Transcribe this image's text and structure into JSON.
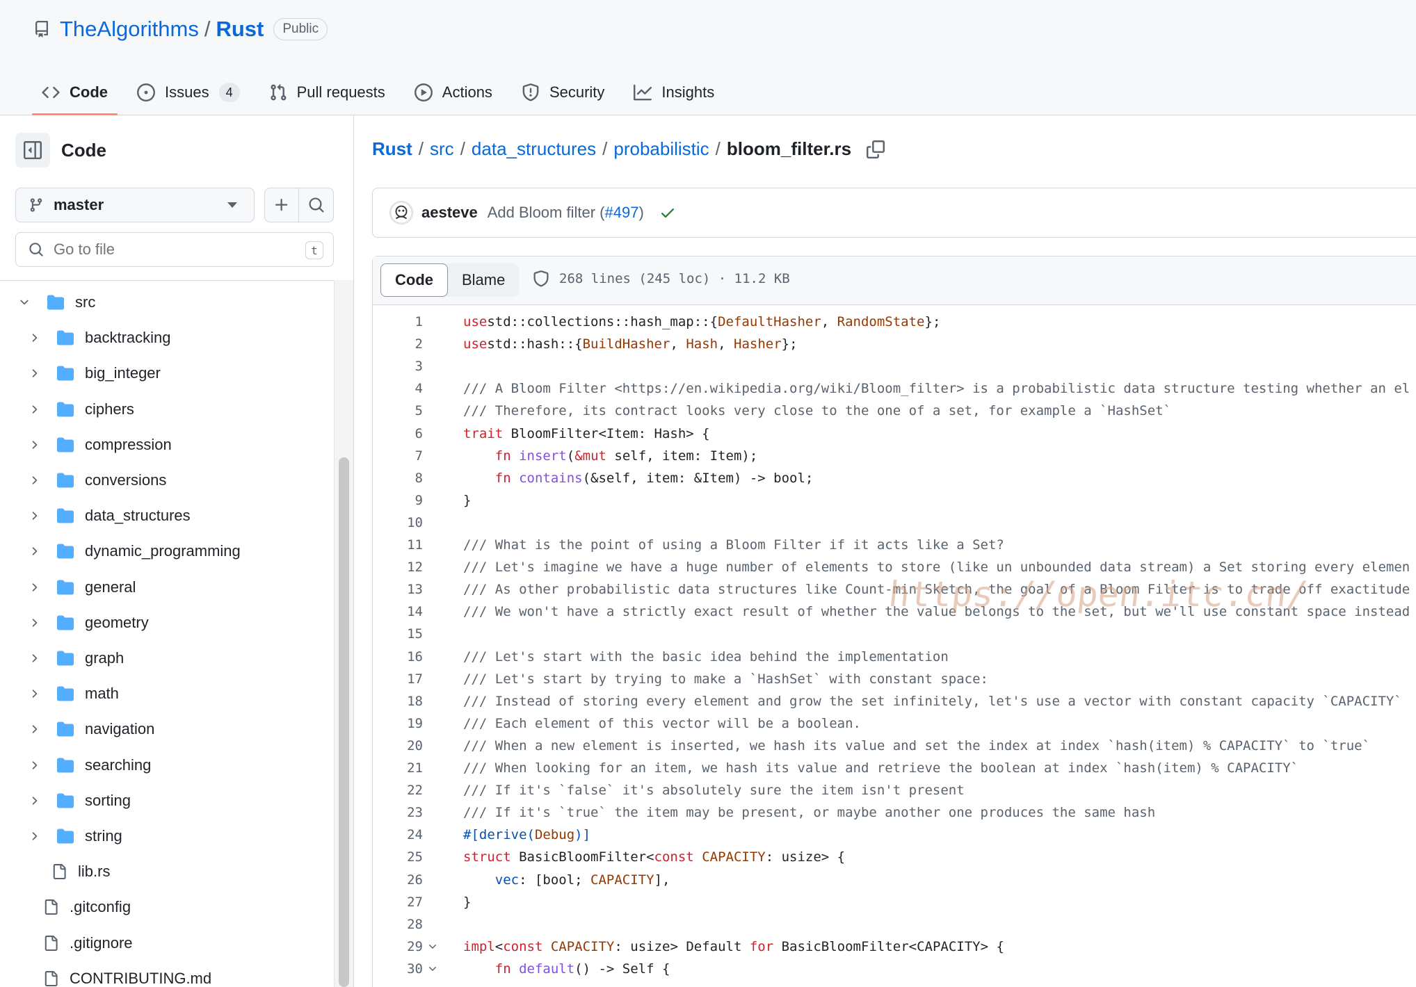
{
  "repo": {
    "owner": "TheAlgorithms",
    "name": "Rust",
    "visibility": "Public"
  },
  "tabs": [
    {
      "label": "Code",
      "active": true,
      "icon": "code-icon"
    },
    {
      "label": "Issues",
      "count": "4",
      "icon": "issue-opened-icon"
    },
    {
      "label": "Pull requests",
      "icon": "pull-request-icon"
    },
    {
      "label": "Actions",
      "icon": "play-icon"
    },
    {
      "label": "Security",
      "icon": "shield-icon"
    },
    {
      "label": "Insights",
      "icon": "graph-icon"
    }
  ],
  "sidebar": {
    "title": "Code",
    "branch": "master",
    "goto_placeholder": "Go to file",
    "goto_shortcut": "t",
    "tree": [
      {
        "name": "src",
        "kind": "folder",
        "expanded": true,
        "depth": 0
      },
      {
        "name": "backtracking",
        "kind": "folder",
        "depth": 1
      },
      {
        "name": "big_integer",
        "kind": "folder",
        "depth": 1
      },
      {
        "name": "ciphers",
        "kind": "folder",
        "depth": 1
      },
      {
        "name": "compression",
        "kind": "folder",
        "depth": 1
      },
      {
        "name": "conversions",
        "kind": "folder",
        "depth": 1
      },
      {
        "name": "data_structures",
        "kind": "folder",
        "depth": 1
      },
      {
        "name": "dynamic_programming",
        "kind": "folder",
        "depth": 1
      },
      {
        "name": "general",
        "kind": "folder",
        "depth": 1
      },
      {
        "name": "geometry",
        "kind": "folder",
        "depth": 1
      },
      {
        "name": "graph",
        "kind": "folder",
        "depth": 1
      },
      {
        "name": "math",
        "kind": "folder",
        "depth": 1
      },
      {
        "name": "navigation",
        "kind": "folder",
        "depth": 1
      },
      {
        "name": "searching",
        "kind": "folder",
        "depth": 1
      },
      {
        "name": "sorting",
        "kind": "folder",
        "depth": 1
      },
      {
        "name": "string",
        "kind": "folder",
        "depth": 1
      },
      {
        "name": "lib.rs",
        "kind": "file",
        "depth": 1
      },
      {
        "name": ".gitconfig",
        "kind": "file",
        "depth": 0
      },
      {
        "name": ".gitignore",
        "kind": "file",
        "depth": 0
      },
      {
        "name": "CONTRIBUTING.md",
        "kind": "file",
        "depth": 0
      }
    ]
  },
  "breadcrumb": {
    "repo": "Rust",
    "parts": [
      "src",
      "data_structures",
      "probabilistic"
    ],
    "current": "bloom_filter.rs"
  },
  "commit": {
    "author": "aesteve",
    "message": "Add Bloom filter (",
    "pr": "#497",
    "message_end": ")"
  },
  "file": {
    "view_tabs": [
      "Code",
      "Blame"
    ],
    "info": "268 lines (245 loc) · 11.2 KB"
  },
  "code_lines": [
    [
      [
        "kw",
        "use"
      ],
      [
        "",
        "std::collections::hash_map::{"
      ],
      [
        "ty",
        "DefaultHasher"
      ],
      [
        "",
        ", "
      ],
      [
        "ty",
        "RandomState"
      ],
      [
        "",
        "};"
      ]
    ],
    [
      [
        "kw",
        "use"
      ],
      [
        "",
        "std::hash::{"
      ],
      [
        "ty",
        "BuildHasher"
      ],
      [
        "",
        ", "
      ],
      [
        "ty",
        "Hash"
      ],
      [
        "",
        ", "
      ],
      [
        "ty",
        "Hasher"
      ],
      [
        "",
        "};"
      ]
    ],
    [],
    [
      [
        "cm",
        "/// A Bloom Filter <https://en.wikipedia.org/wiki/Bloom_filter> is a probabilistic data structure testing whether an el"
      ]
    ],
    [
      [
        "cm",
        "/// Therefore, its contract looks very close to the one of a set, for example a `HashSet`"
      ]
    ],
    [
      [
        "kw",
        "trait"
      ],
      [
        "",
        " BloomFilter<Item: Hash> {"
      ]
    ],
    [
      [
        "",
        "    "
      ],
      [
        "kw",
        "fn"
      ],
      [
        "fn",
        " insert"
      ],
      [
        "",
        "("
      ],
      [
        "kw",
        "&mut"
      ],
      [
        "",
        " self, item: Item);"
      ]
    ],
    [
      [
        "",
        "    "
      ],
      [
        "kw",
        "fn"
      ],
      [
        "fn",
        " contains"
      ],
      [
        "",
        "(&self, item: &Item) -> bool;"
      ]
    ],
    [
      [
        "",
        "}"
      ]
    ],
    [],
    [
      [
        "cm",
        "/// What is the point of using a Bloom Filter if it acts like a Set?"
      ]
    ],
    [
      [
        "cm",
        "/// Let's imagine we have a huge number of elements to store (like un unbounded data stream) a Set storing every elemen"
      ]
    ],
    [
      [
        "cm",
        "/// As other probabilistic data structures like Count-min Sketch, the goal of a Bloom Filter is to trade off exactitude"
      ]
    ],
    [
      [
        "cm",
        "/// We won't have a strictly exact result of whether the value belongs to the set, but we'll use constant space instead"
      ]
    ],
    [],
    [
      [
        "cm",
        "/// Let's start with the basic idea behind the implementation"
      ]
    ],
    [
      [
        "cm",
        "/// Let's start by trying to make a `HashSet` with constant space:"
      ]
    ],
    [
      [
        "cm",
        "/// Instead of storing every element and grow the set infinitely, let's use a vector with constant capacity `CAPACITY`"
      ]
    ],
    [
      [
        "cm",
        "/// Each element of this vector will be a boolean."
      ]
    ],
    [
      [
        "cm",
        "/// When a new element is inserted, we hash its value and set the index at index `hash(item) % CAPACITY` to `true`"
      ]
    ],
    [
      [
        "cm",
        "/// When looking for an item, we hash its value and retrieve the boolean at index `hash(item) % CAPACITY`"
      ]
    ],
    [
      [
        "cm",
        "/// If it's `false` it's absolutely sure the item isn't present"
      ]
    ],
    [
      [
        "cm",
        "/// If it's `true` the item may be present, or maybe another one produces the same hash"
      ]
    ],
    [
      [
        "at",
        "#[derive("
      ],
      [
        "ty",
        "Debug"
      ],
      [
        "at",
        ")]"
      ]
    ],
    [
      [
        "kw",
        "struct"
      ],
      [
        "",
        " BasicBloomFilter<"
      ],
      [
        "kw",
        "const"
      ],
      [
        "ty",
        " CAPACITY"
      ],
      [
        "",
        ": usize> {"
      ]
    ],
    [
      [
        "",
        "    "
      ],
      [
        "at",
        "vec"
      ],
      [
        "",
        ": [bool; "
      ],
      [
        "ty",
        "CAPACITY"
      ],
      [
        "",
        "],"
      ]
    ],
    [
      [
        "",
        "}"
      ]
    ],
    [],
    [
      [
        "kw",
        "impl"
      ],
      [
        "",
        "<"
      ],
      [
        "kw",
        "const"
      ],
      [
        "ty",
        " CAPACITY"
      ],
      [
        "",
        ": usize> Default "
      ],
      [
        "kw",
        "for"
      ],
      [
        "",
        " BasicBloomFilter<CAPACITY> {"
      ]
    ],
    [
      [
        "",
        "    "
      ],
      [
        "kw",
        "fn"
      ],
      [
        "fn",
        " default"
      ],
      [
        "",
        "() -> Self {"
      ]
    ]
  ],
  "folded_lines": [
    29,
    30
  ],
  "watermark": "https://open.itc.cn/"
}
